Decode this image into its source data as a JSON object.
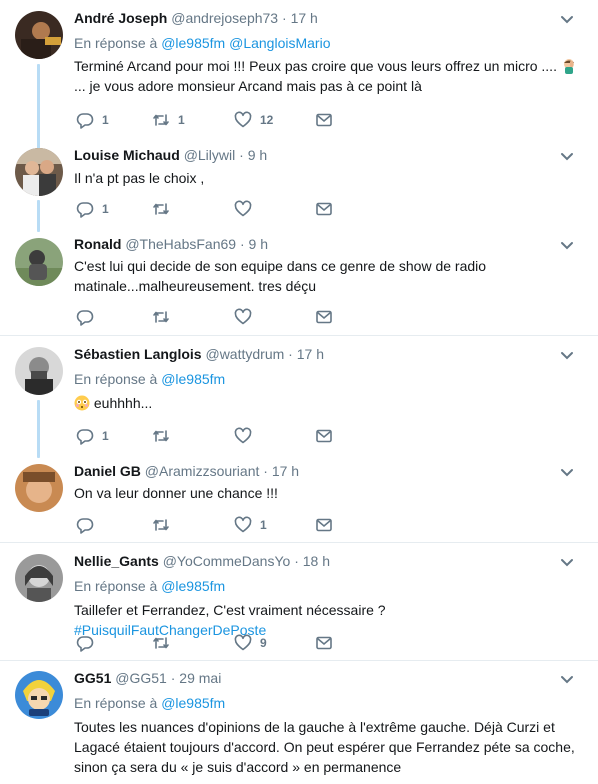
{
  "tweets": [
    {
      "name": "André Joseph",
      "handle": "@andrejoseph73",
      "time": "17 h",
      "reply_prefix": "En réponse à",
      "reply_to": [
        "@le985fm",
        "@LangloisMario"
      ],
      "text_line1": "Terminé  Arcand pour moi !!! Peux pas croire que vous leurs offrez un micro ....",
      "text_line2": "... je vous adore monsieur Arcand mais pas à ce point là",
      "replies": "1",
      "retweets": "1",
      "likes": "12"
    },
    {
      "name": "Louise Michaud",
      "handle": "@Lilywil",
      "time": "9 h",
      "text": "Il n'a pt pas le choix ,",
      "replies": "1",
      "retweets": "",
      "likes": ""
    },
    {
      "name": "Ronald",
      "handle": "@TheHabsFan69",
      "time": "9 h",
      "text_line1": "C'est lui qui decide de son equipe dans ce genre de show de radio",
      "text_line2": "matinale...malheureusement. tres déçu",
      "replies": "",
      "retweets": "",
      "likes": ""
    },
    {
      "name": "Sébastien Langlois",
      "handle": "@wattydrum",
      "time": "17 h",
      "reply_prefix": "En réponse à",
      "reply_to": [
        "@le985fm"
      ],
      "text": "euhhhh...",
      "replies": "1",
      "retweets": "",
      "likes": ""
    },
    {
      "name": "Daniel GB",
      "handle": "@Aramizzsouriant",
      "time": "17 h",
      "text": "On va leur donner une chance !!!",
      "replies": "",
      "retweets": "",
      "likes": "1"
    },
    {
      "name": "Nellie_Gants",
      "handle": "@YoCommeDansYo",
      "time": "18 h",
      "reply_prefix": "En réponse à",
      "reply_to": [
        "@le985fm"
      ],
      "text": "Taillefer et Ferrandez, C'est vraiment nécessaire ?",
      "hashtag": "#PuisquilFautChangerDePoste",
      "replies": "",
      "retweets": "",
      "likes": "9"
    },
    {
      "name": "GG51",
      "handle": "@GG51",
      "time": "29 mai",
      "reply_prefix": "En réponse à",
      "reply_to": [
        "@le985fm"
      ],
      "text_line1": "Toutes les nuances d'opinions de la gauche à l'extrême gauche. Déjà Curzi et",
      "text_line2": "Lagacé étaient toujours d'accord. On peut espérer que Ferrandez péte sa coche,",
      "text_line3": "sinon ça sera du « je suis d'accord » en permanence"
    }
  ],
  "colors": {
    "accent": "#1b95e0",
    "muted": "#657786",
    "thread_line": "#b8dcf5",
    "separator": "#e6ecf0"
  },
  "icons": [
    "reply-icon",
    "retweet-icon",
    "like-icon",
    "message-icon",
    "chevron-down-icon"
  ]
}
